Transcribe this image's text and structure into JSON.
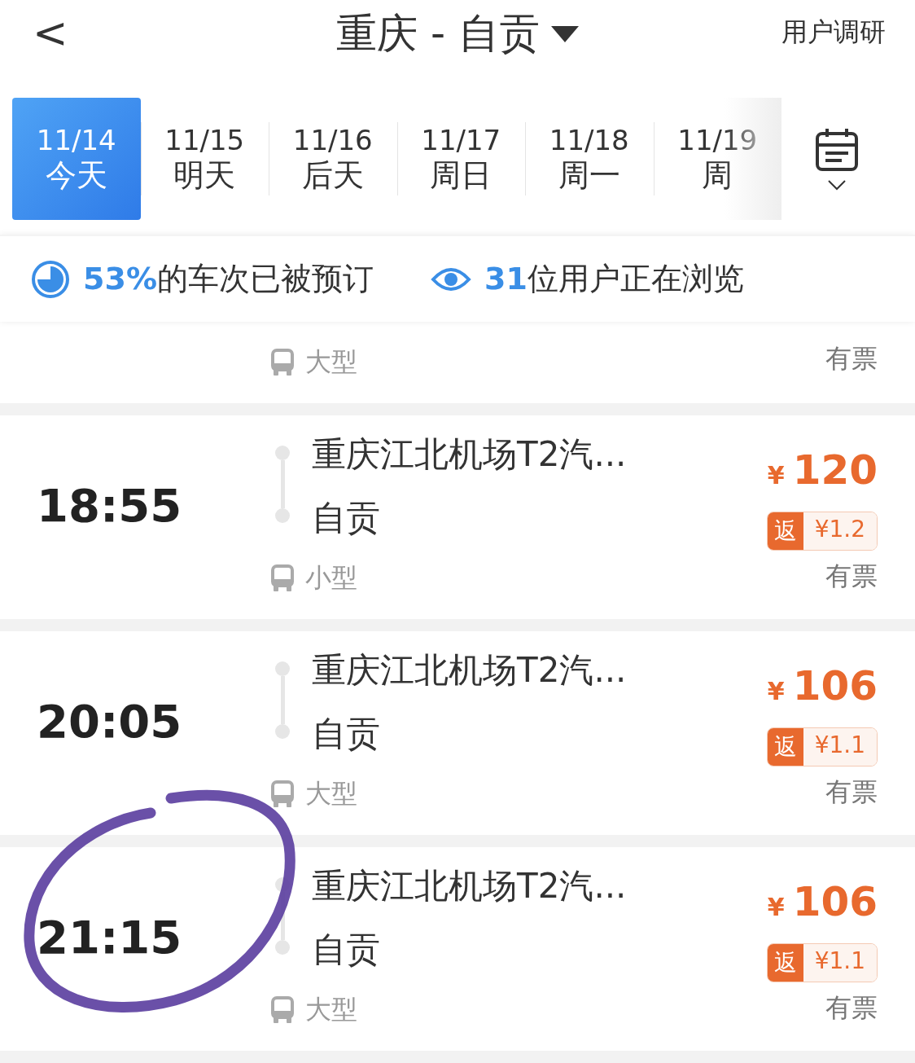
{
  "header": {
    "back": "<",
    "title": "重庆 - 自贡",
    "action": "用户调研"
  },
  "dates": [
    {
      "date": "11/14",
      "day": "今天",
      "selected": true
    },
    {
      "date": "11/15",
      "day": "明天",
      "selected": false
    },
    {
      "date": "11/16",
      "day": "后天",
      "selected": false
    },
    {
      "date": "11/17",
      "day": "周日",
      "selected": false
    },
    {
      "date": "11/18",
      "day": "周一",
      "selected": false
    },
    {
      "date": "11/19",
      "day": "周",
      "selected": false
    }
  ],
  "stats": [
    {
      "kind": "booked",
      "value": "53%",
      "text": "的车次已被预订"
    },
    {
      "kind": "viewing",
      "value": "31",
      "text": "位用户正在浏览"
    }
  ],
  "trips": [
    {
      "kind": "partial",
      "bus": "大型",
      "status": "有票",
      "circled": false
    },
    {
      "kind": "full",
      "time": "18:55",
      "from": "重庆江北机场T2汽...",
      "to": "自贡",
      "currency": "¥",
      "price": "120",
      "rebate_label": "返",
      "rebate": "¥1.2",
      "bus": "小型",
      "status": "有票",
      "circled": false
    },
    {
      "kind": "full",
      "time": "20:05",
      "from": "重庆江北机场T2汽...",
      "to": "自贡",
      "currency": "¥",
      "price": "106",
      "rebate_label": "返",
      "rebate": "¥1.1",
      "bus": "大型",
      "status": "有票",
      "circled": false
    },
    {
      "kind": "full",
      "time": "21:15",
      "from": "重庆江北机场T2汽...",
      "to": "自贡",
      "currency": "¥",
      "price": "106",
      "rebate_label": "返",
      "rebate": "¥1.1",
      "bus": "大型",
      "status": "有票",
      "circled": true
    }
  ]
}
